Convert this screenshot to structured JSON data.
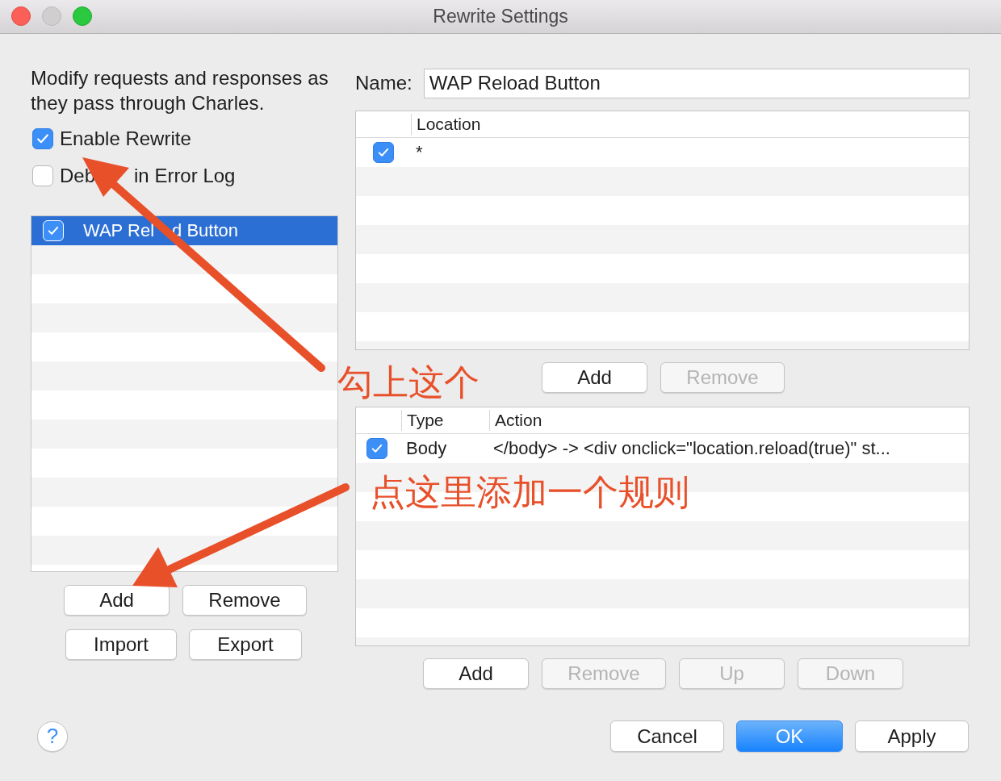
{
  "window": {
    "title": "Rewrite Settings"
  },
  "description": "Modify requests and responses as they pass through Charles.",
  "options": [
    {
      "label": "Enable Rewrite",
      "checked": true
    },
    {
      "label_parts": [
        "Deb",
        "in Error Log"
      ],
      "checked": false
    }
  ],
  "sets": {
    "rows": [
      {
        "label_parts": [
          "WAP Rel",
          "d Button"
        ],
        "checked": true,
        "selected": true
      }
    ]
  },
  "set_buttons": [
    {
      "label": "Add",
      "disabled": false
    },
    {
      "label": "Remove",
      "disabled": false
    },
    {
      "label": "Import",
      "disabled": false
    },
    {
      "label": "Export",
      "disabled": false
    }
  ],
  "name_field": {
    "label": "Name:",
    "value": "WAP Reload Button"
  },
  "locations": {
    "columns": [
      "Location"
    ],
    "rows": [
      {
        "checked": true,
        "location": "*"
      }
    ]
  },
  "location_buttons": [
    {
      "label": "Add",
      "disabled": false
    },
    {
      "label": "Remove",
      "disabled": true
    }
  ],
  "rules": {
    "columns": [
      "Type",
      "Action"
    ],
    "rows": [
      {
        "checked": true,
        "type": "Body",
        "action": "</body> -> <div onclick=\"location.reload(true)\" st..."
      }
    ]
  },
  "rule_buttons": [
    {
      "label": "Add",
      "disabled": false
    },
    {
      "label": "Remove",
      "disabled": true
    },
    {
      "label": "Up",
      "disabled": true
    },
    {
      "label": "Down",
      "disabled": true
    }
  ],
  "annotations": [
    {
      "text": "勾上这个"
    },
    {
      "text": "点这里添加一个规则"
    }
  ],
  "help": {
    "label": "?"
  },
  "dialog_buttons": [
    {
      "label": "Cancel",
      "default": false
    },
    {
      "label": "OK",
      "default": true
    },
    {
      "label": "Apply",
      "default": false
    }
  ]
}
